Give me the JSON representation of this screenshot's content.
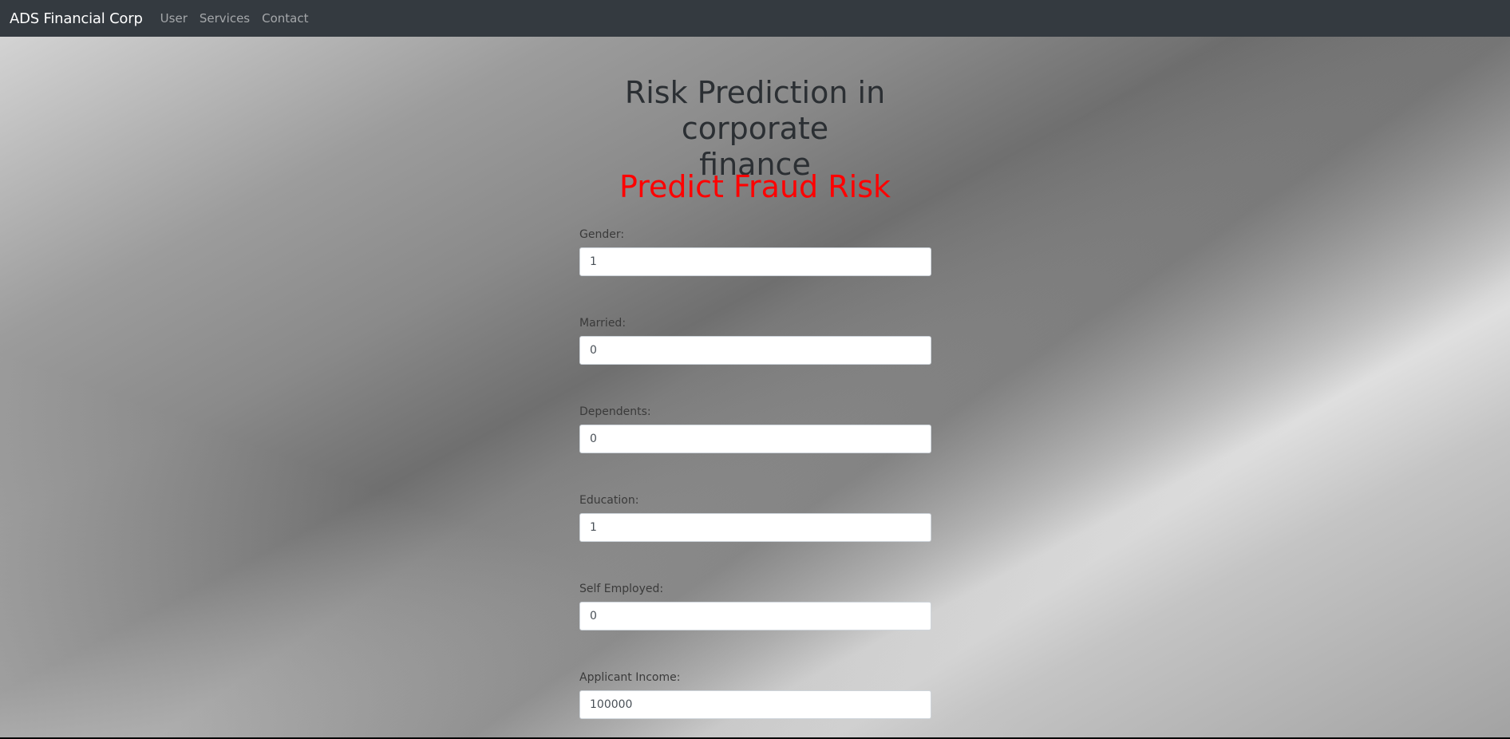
{
  "navbar": {
    "brand": "ADS Financial Corp",
    "links": [
      "User",
      "Services",
      "Contact"
    ]
  },
  "page": {
    "title": "Risk Prediction in corporate finance",
    "subtitle": "Predict Fraud Risk"
  },
  "form": {
    "fields": [
      {
        "label": "Gender:",
        "value": "1"
      },
      {
        "label": "Married:",
        "value": "0"
      },
      {
        "label": "Dependents:",
        "value": "0"
      },
      {
        "label": "Education:",
        "value": "1"
      },
      {
        "label": "Self Employed:",
        "value": "0"
      },
      {
        "label": "Applicant Income:",
        "value": "100000"
      }
    ]
  },
  "colors": {
    "navbar_bg": "#343a40",
    "subtitle": "#ff0000"
  }
}
